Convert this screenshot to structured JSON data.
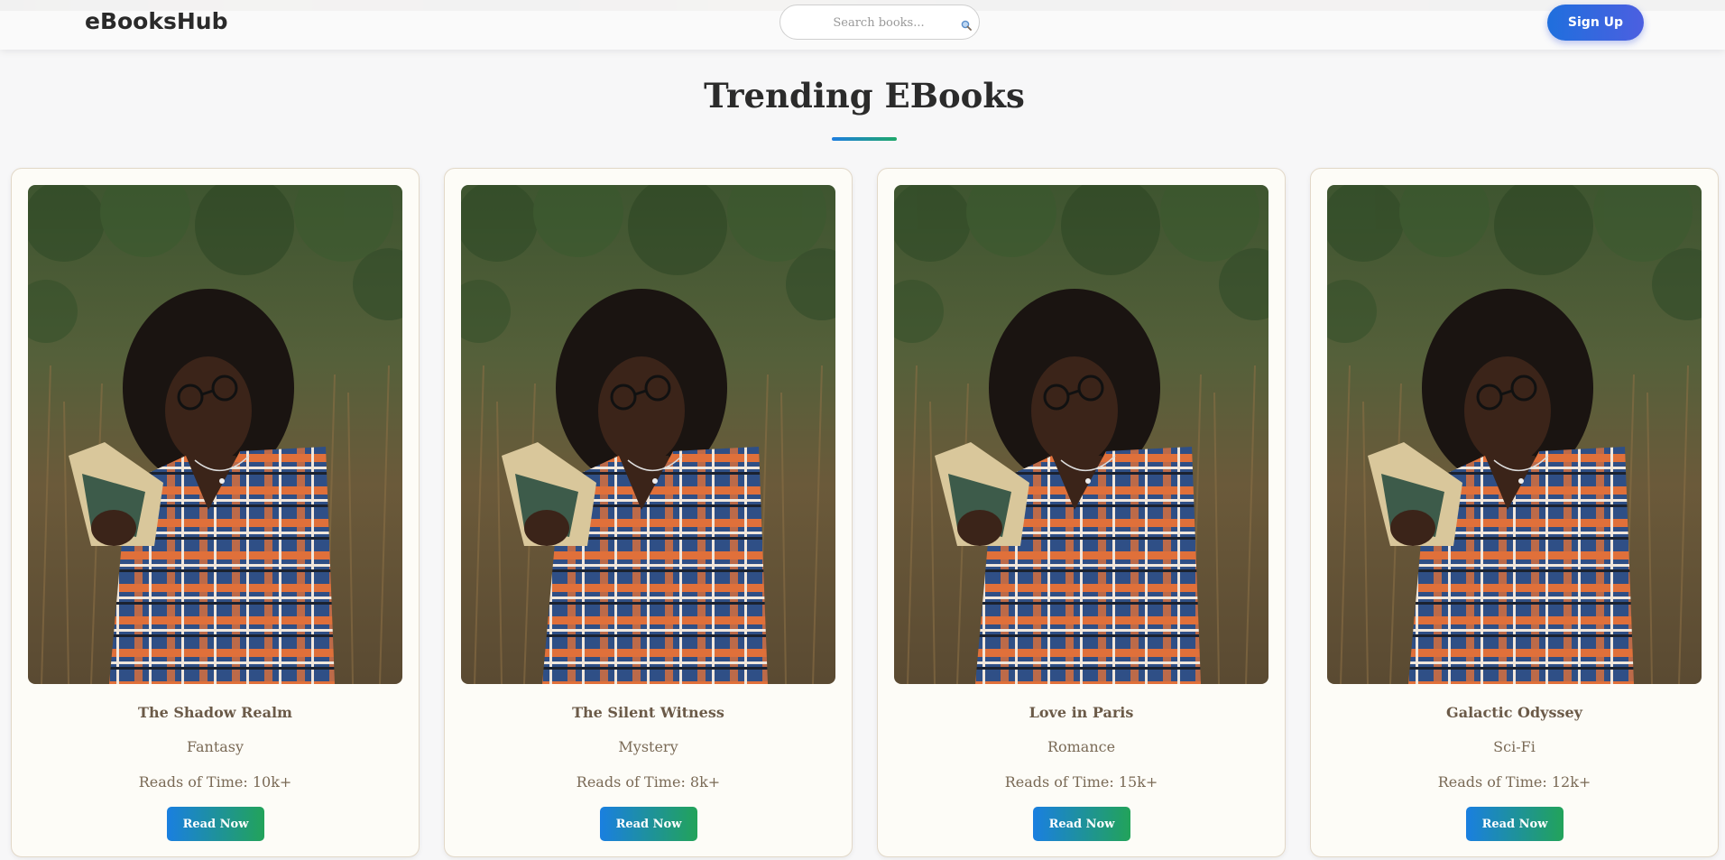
{
  "header": {
    "logo": "eBooksHub",
    "search_placeholder": "Search books...",
    "search_icon": "search-icon",
    "signup_label": "Sign Up"
  },
  "main": {
    "title": "Trending EBooks"
  },
  "books": [
    {
      "title": "The Shadow Realm",
      "genre": "Fantasy",
      "reads": "Reads of Time: 10k+",
      "button": "Read Now"
    },
    {
      "title": "The Silent Witness",
      "genre": "Mystery",
      "reads": "Reads of Time: 8k+",
      "button": "Read Now"
    },
    {
      "title": "Love in Paris",
      "genre": "Romance",
      "reads": "Reads of Time: 15k+",
      "button": "Read Now"
    },
    {
      "title": "Galactic Odyssey",
      "genre": "Sci-Fi",
      "reads": "Reads of Time: 12k+",
      "button": "Read Now"
    }
  ],
  "colors": {
    "brand_gradient_start": "#1a7fe0",
    "brand_gradient_end": "#22a35a",
    "signup_gradient_start": "#1f6fdd",
    "signup_gradient_end": "#4c5fe0"
  }
}
